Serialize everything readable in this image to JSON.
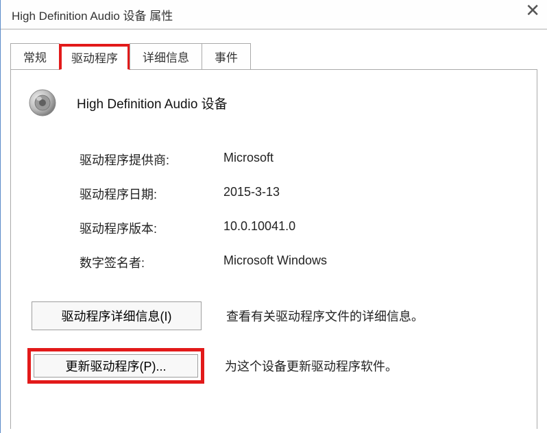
{
  "titlebar": {
    "title": "High Definition Audio 设备 属性",
    "close": "✕"
  },
  "tabs": [
    {
      "label": "常规"
    },
    {
      "label": "驱动程序"
    },
    {
      "label": "详细信息"
    },
    {
      "label": "事件"
    }
  ],
  "device": {
    "name": "High Definition Audio 设备",
    "icon": "speaker-icon"
  },
  "info": {
    "provider_label": "驱动程序提供商:",
    "provider_value": "Microsoft",
    "date_label": "驱动程序日期:",
    "date_value": "2015-3-13",
    "version_label": "驱动程序版本:",
    "version_value": "10.0.10041.0",
    "signer_label": "数字签名者:",
    "signer_value": "Microsoft Windows"
  },
  "actions": {
    "details_button": "驱动程序详细信息(I)",
    "details_desc": "查看有关驱动程序文件的详细信息。",
    "update_button": "更新驱动程序(P)...",
    "update_desc": "为这个设备更新驱动程序软件。"
  }
}
